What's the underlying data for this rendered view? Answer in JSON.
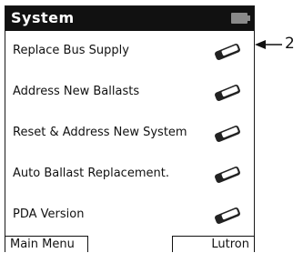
{
  "window": {
    "title": "System"
  },
  "menu": {
    "items": [
      {
        "label": "Replace Bus Supply",
        "icon": "button-key-icon"
      },
      {
        "label": "Address New Ballasts",
        "icon": "button-key-icon"
      },
      {
        "label": "Reset & Address New System",
        "icon": "button-key-icon"
      },
      {
        "label": "Auto Ballast Replacement.",
        "icon": "button-key-icon"
      },
      {
        "label": "PDA Version",
        "icon": "button-key-icon"
      }
    ]
  },
  "softkeys": {
    "left": "Main Menu",
    "right": "Lutron"
  },
  "callout": {
    "number": "2"
  },
  "colors": {
    "titlebar": "#111111",
    "background": "#ffffff",
    "battery": "#8a8a8a"
  }
}
